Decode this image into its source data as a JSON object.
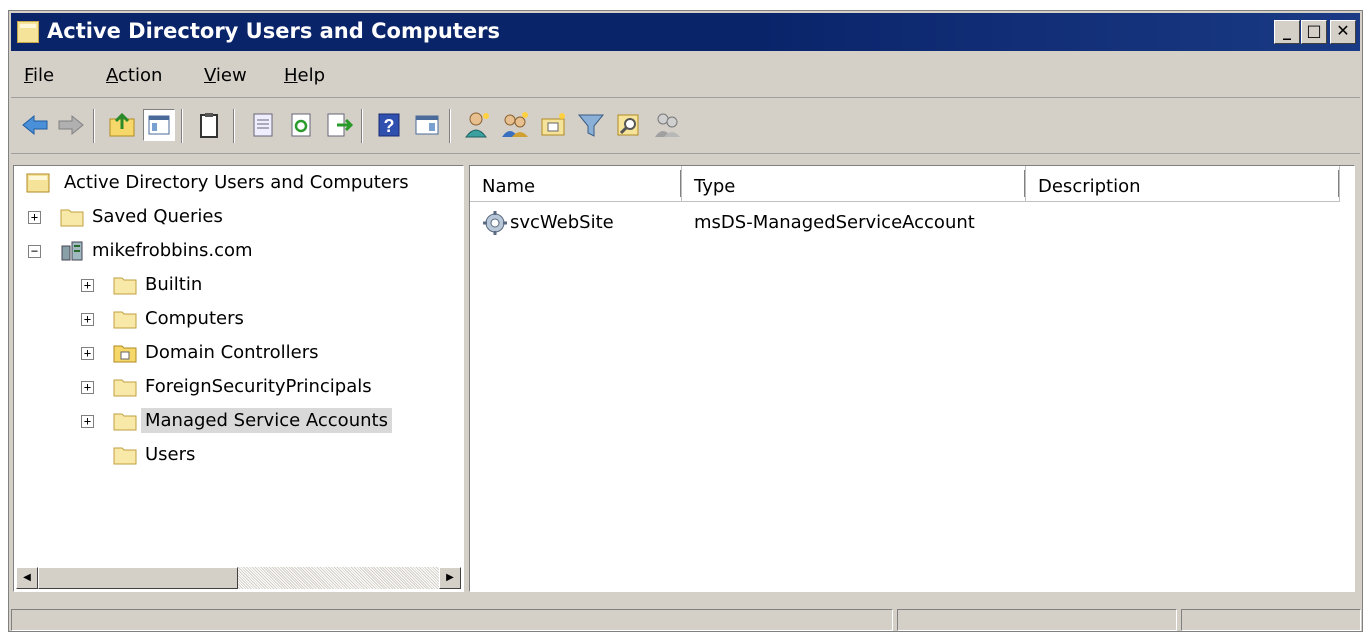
{
  "window": {
    "title": "Active Directory Users and Computers",
    "minimize": "_",
    "maximize": "□",
    "close": "✕"
  },
  "menu": [
    "File",
    "Action",
    "View",
    "Help"
  ],
  "menu_accel": [
    "F",
    "A",
    "V",
    "H"
  ],
  "tree": {
    "root": "Active Directory Users and Computers",
    "saved_queries": "Saved Queries",
    "domain": "mikefrobbins.com",
    "children": [
      "Builtin",
      "Computers",
      "Domain Controllers",
      "ForeignSecurityPrincipals",
      "Managed Service Accounts",
      "Users"
    ],
    "selected": "Managed Service Accounts"
  },
  "list": {
    "columns": [
      "Name",
      "Type",
      "Description"
    ],
    "rows": [
      {
        "name": "svcWebSite",
        "type": "msDS-ManagedServiceAccount",
        "description": ""
      }
    ]
  },
  "colors": {
    "title_bg": "#0a246a",
    "chrome": "#d4d0c8",
    "selection": "#d9d9d9",
    "folder": "#f6e39a"
  },
  "icons": [
    "back-arrow-icon",
    "forward-arrow-icon",
    "up-folder-icon",
    "show-hide-console-tree-icon",
    "clipboard-icon",
    "properties-icon",
    "refresh-icon",
    "export-list-icon",
    "help-icon",
    "show-hide-action-pane-icon",
    "new-user-icon",
    "new-group-icon",
    "new-ou-icon",
    "filter-icon",
    "find-icon",
    "add-to-group-icon"
  ]
}
